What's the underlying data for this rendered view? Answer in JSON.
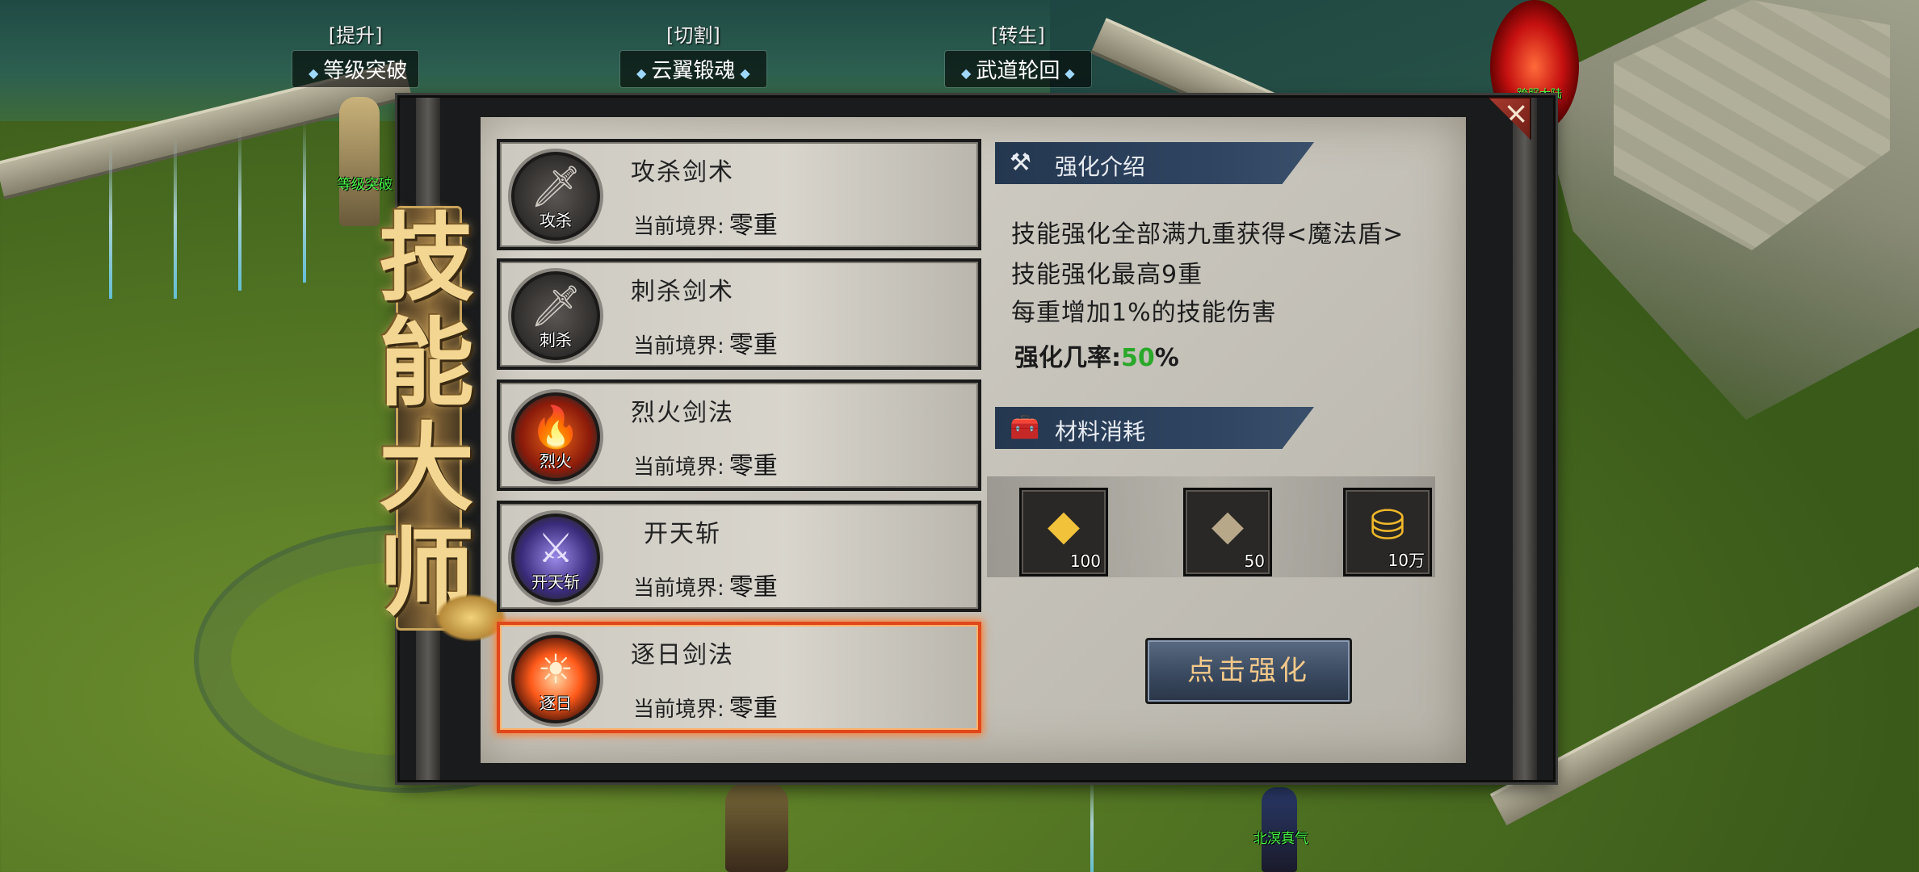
{
  "top_menus": [
    {
      "tag": "[提升]",
      "label": "等级突破"
    },
    {
      "tag": "[切割]",
      "label": "云翼锻魂"
    },
    {
      "tag": "[转生]",
      "label": "武道轮回"
    }
  ],
  "panel": {
    "title_glyphs": [
      "技",
      "能",
      "大",
      "师"
    ],
    "close_label": "×"
  },
  "skills": [
    {
      "name": "攻杀剑术",
      "icon_label": "攻杀",
      "realm_label": "当前境界:",
      "realm_value": "零重",
      "icon": "sword-icon",
      "selected": false
    },
    {
      "name": "刺杀剑术",
      "icon_label": "刺杀",
      "realm_label": "当前境界:",
      "realm_value": "零重",
      "icon": "sword-icon",
      "selected": false
    },
    {
      "name": "烈火剑法",
      "icon_label": "烈火",
      "realm_label": "当前境界:",
      "realm_value": "零重",
      "icon": "fire-sword-icon",
      "selected": false
    },
    {
      "name": "开天斩",
      "icon_label": "开天斩",
      "realm_label": "当前境界:",
      "realm_value": "零重",
      "icon": "purple-slash-icon",
      "selected": false
    },
    {
      "name": "逐日剑法",
      "icon_label": "逐日",
      "realm_label": "当前境界:",
      "realm_value": "零重",
      "icon": "sun-slash-icon",
      "selected": true
    }
  ],
  "intro": {
    "header": "强化介绍",
    "lines": [
      "技能强化全部满九重获得<魔法盾>",
      "技能强化最高9重",
      "每重增加1%的技能伤害"
    ],
    "rate_label": "强化几率:",
    "rate_value": "50",
    "rate_unit": "%"
  },
  "materials": {
    "header": "材料消耗",
    "items": [
      {
        "icon": "gold-ore-icon",
        "qty": "100"
      },
      {
        "icon": "black-iron-icon",
        "qty": "50"
      },
      {
        "icon": "gold-ingot-icon",
        "qty": "10万"
      }
    ]
  },
  "action_button": "点击强化",
  "world_labels": {
    "npc_top": "等级突破",
    "npc_bottom": "北溟真气",
    "portal": "跨服大陆"
  },
  "colors": {
    "rate_green": "#2aa82a",
    "selected_border": "#e0471a",
    "npc_label_green": "#4cff4c"
  }
}
